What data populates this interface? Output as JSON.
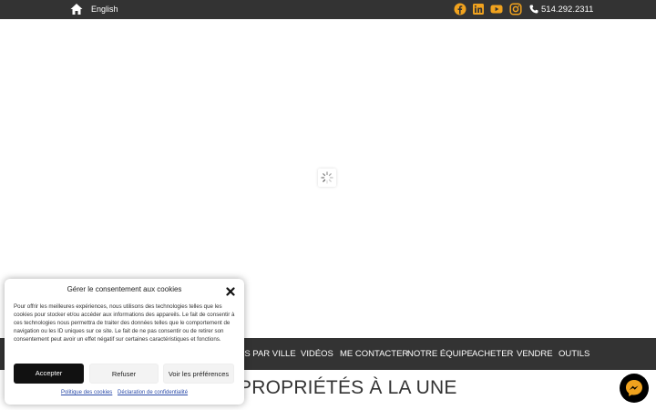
{
  "topbar": {
    "language_link": "English",
    "phone": "514.292.2311",
    "social_icons": [
      "facebook-icon",
      "linkedin-icon",
      "youtube-icon",
      "instagram-icon"
    ],
    "icon_color": "#f0a21e"
  },
  "nav": {
    "items": [
      {
        "label": "ÉS PAR VILLE"
      },
      {
        "label": "VIDÉOS"
      },
      {
        "label": "ME CONTACTER"
      },
      {
        "label": "NOTRE ÉQUIPE"
      },
      {
        "label": "ACHETER"
      },
      {
        "label": "VENDRE"
      },
      {
        "label": "OUTILS"
      }
    ]
  },
  "main": {
    "section_title": "PROPRIÉTÉS À LA UNE"
  },
  "cookie": {
    "title": "Gérer le consentement aux cookies",
    "body": "Pour offrir les meilleures expériences, nous utilisons des technologies telles que les cookies pour stocker et/ou accéder aux informations des appareils. Le fait de consentir à ces technologies nous permettra de traiter des données telles que le comportement de navigation ou les ID uniques sur ce site. Le fait de ne pas consentir ou de retirer son consentement peut avoir un effet négatif sur certaines caractéristiques et fonctions.",
    "accept_label": "Accepter",
    "refuse_label": "Refuser",
    "prefs_label": "Voir les préférences",
    "policy_link": "Politique des cookies",
    "privacy_link": "Déclaration de confidentialité"
  }
}
